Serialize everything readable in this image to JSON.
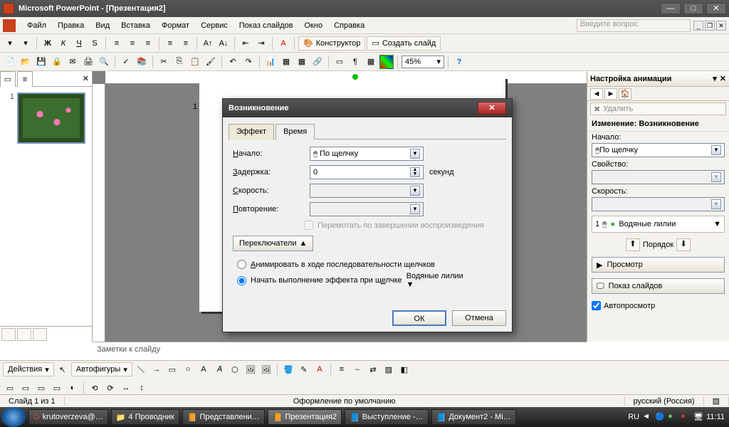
{
  "titlebar": {
    "title": "Microsoft PowerPoint - [Презентация2]"
  },
  "menubar": {
    "items": [
      "Файл",
      "Правка",
      "Вид",
      "Вставка",
      "Формат",
      "Сервис",
      "Показ слайдов",
      "Окно",
      "Справка"
    ],
    "search_placeholder": "Введите вопрос"
  },
  "toolbar": {
    "designer": "Конструктор",
    "new_slide": "Создать слайд",
    "zoom": "45%"
  },
  "slides": {
    "num": "1"
  },
  "notes_placeholder": "Заметки к слайду",
  "drawbar": {
    "actions": "Действия",
    "autoshapes": "Автофигуры"
  },
  "status": {
    "slide": "Слайд 1 из 1",
    "design": "Оформление по умолчанию",
    "lang": "русский (Россия)"
  },
  "taskpane": {
    "title": "Настройка анимации",
    "delete": "Удалить",
    "change_label": "Изменение: Возникновение",
    "start_label": "Начало:",
    "start_value": "По щелчку",
    "property_label": "Свойство:",
    "speed_label": "Скорость:",
    "item_num": "1",
    "item_name": "Водяные лилии",
    "order": "Порядок",
    "preview": "Просмотр",
    "slideshow": "Показ слайдов",
    "autopreview": "Автопросмотр"
  },
  "dialog": {
    "title": "Возникновение",
    "tab_effect": "Эффект",
    "tab_timing": "Время",
    "start_label": "Начало:",
    "start_value": "По щелчку",
    "delay_label": "Задержка:",
    "delay_value": "0",
    "delay_unit": "секунд",
    "speed_label": "Скорость:",
    "repeat_label": "Повторение:",
    "rewind": "Перемотать по завершении воспроизведения",
    "triggers": "Переключатели",
    "radio1": "Анимировать в ходе последовательности щелчков",
    "radio2": "Начать выполнение эффекта при щелчке",
    "trigger_obj": "Водяные лилии",
    "ok": "ОК",
    "cancel": "Отмена"
  },
  "taskbar": {
    "items": [
      "krutoverzeva@…",
      "4 Проводник",
      "Представлени…",
      "Презентация2",
      "Выступление -…",
      "Документ2 - Mi…"
    ],
    "lang": "RU",
    "time": "11:11"
  }
}
